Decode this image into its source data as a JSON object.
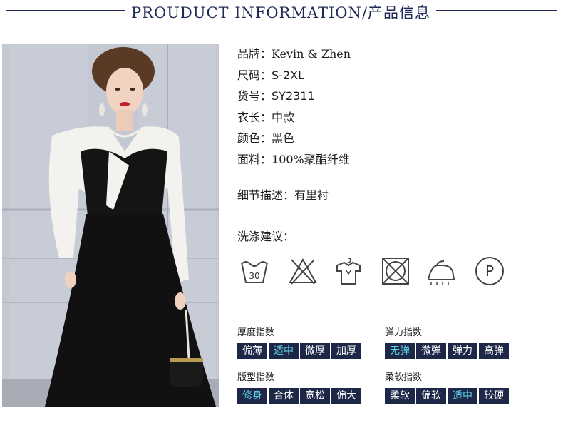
{
  "header": {
    "title": "PROUDUCT INFORMATION/产品信息"
  },
  "specs": [
    {
      "key": "品牌：",
      "value": "Kevin & Zhen"
    },
    {
      "key": "尺码：",
      "value": "S-2XL"
    },
    {
      "key": "货号：",
      "value": "SY2311"
    },
    {
      "key": "衣长：",
      "value": "中款"
    },
    {
      "key": "颜色：",
      "value": "黑色"
    },
    {
      "key": "面料：",
      "value": "100%聚酯纤维"
    }
  ],
  "detail": {
    "key": "细节描述：",
    "value": "有里衬"
  },
  "care": {
    "title": "洗涤建议：",
    "icons": [
      "wash-30-icon",
      "do-not-bleach-icon",
      "hang-dry-icon",
      "do-not-tumble-dry-icon",
      "low-iron-icon",
      "dry-clean-p-icon"
    ],
    "wash_temp": "30",
    "dry_clean_letter": "P"
  },
  "indices": {
    "thickness": {
      "label": "厚度指数",
      "options": [
        "偏薄",
        "适中",
        "微厚",
        "加厚"
      ],
      "selected": 1
    },
    "elasticity": {
      "label": "弹力指数",
      "options": [
        "无弹",
        "微弹",
        "弹力",
        "高弹"
      ],
      "selected": 0
    },
    "fit": {
      "label": "版型指数",
      "options": [
        "修身",
        "合体",
        "宽松",
        "偏大"
      ],
      "selected": 0
    },
    "softness": {
      "label": "柔软指数",
      "options": [
        "柔软",
        "偏软",
        "适中",
        "较硬"
      ],
      "selected": 2
    }
  },
  "colors": {
    "navy": "#1f2a56",
    "chip": "#1d2748",
    "selected_text": "#5fd3ea"
  }
}
